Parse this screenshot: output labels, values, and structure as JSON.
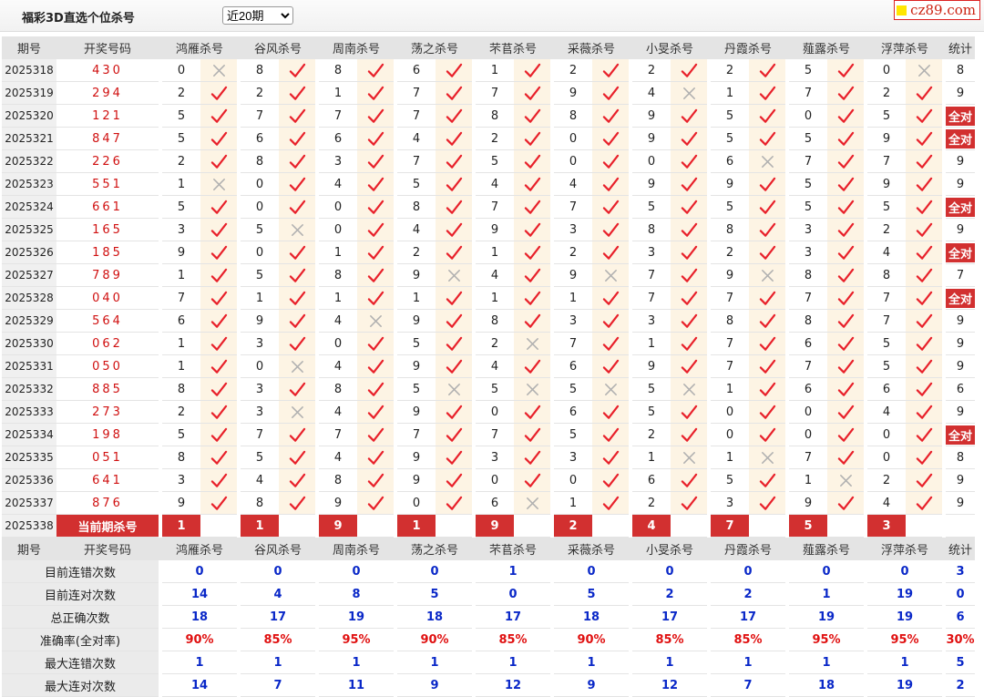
{
  "header": {
    "title": "福彩3D直选个位杀号",
    "range_selected": "近20期",
    "logo_text": "cz89.com"
  },
  "columns": {
    "period": "期号",
    "draw": "开奖号码",
    "stat": "统计",
    "experts": [
      "鸿雁杀号",
      "谷风杀号",
      "周南杀号",
      "荡之杀号",
      "芣苢杀号",
      "采薇杀号",
      "小旻杀号",
      "丹霞杀号",
      "薤露杀号",
      "浮萍杀号"
    ]
  },
  "rows": [
    {
      "period": "2025318",
      "draw": "430",
      "kills": [
        [
          "0",
          "x"
        ],
        [
          "8",
          "v"
        ],
        [
          "8",
          "v"
        ],
        [
          "6",
          "v"
        ],
        [
          "1",
          "v"
        ],
        [
          "2",
          "v"
        ],
        [
          "2",
          "v"
        ],
        [
          "2",
          "v"
        ],
        [
          "5",
          "v"
        ],
        [
          "0",
          "x"
        ]
      ],
      "stat": "8"
    },
    {
      "period": "2025319",
      "draw": "294",
      "kills": [
        [
          "2",
          "v"
        ],
        [
          "2",
          "v"
        ],
        [
          "1",
          "v"
        ],
        [
          "7",
          "v"
        ],
        [
          "7",
          "v"
        ],
        [
          "9",
          "v"
        ],
        [
          "4",
          "x"
        ],
        [
          "1",
          "v"
        ],
        [
          "7",
          "v"
        ],
        [
          "2",
          "v"
        ]
      ],
      "stat": "9"
    },
    {
      "period": "2025320",
      "draw": "121",
      "kills": [
        [
          "5",
          "v"
        ],
        [
          "7",
          "v"
        ],
        [
          "7",
          "v"
        ],
        [
          "7",
          "v"
        ],
        [
          "8",
          "v"
        ],
        [
          "8",
          "v"
        ],
        [
          "9",
          "v"
        ],
        [
          "5",
          "v"
        ],
        [
          "0",
          "v"
        ],
        [
          "5",
          "v"
        ]
      ],
      "stat": "全对"
    },
    {
      "period": "2025321",
      "draw": "847",
      "kills": [
        [
          "5",
          "v"
        ],
        [
          "6",
          "v"
        ],
        [
          "6",
          "v"
        ],
        [
          "4",
          "v"
        ],
        [
          "2",
          "v"
        ],
        [
          "0",
          "v"
        ],
        [
          "9",
          "v"
        ],
        [
          "5",
          "v"
        ],
        [
          "5",
          "v"
        ],
        [
          "9",
          "v"
        ]
      ],
      "stat": "全对"
    },
    {
      "period": "2025322",
      "draw": "226",
      "kills": [
        [
          "2",
          "v"
        ],
        [
          "8",
          "v"
        ],
        [
          "3",
          "v"
        ],
        [
          "7",
          "v"
        ],
        [
          "5",
          "v"
        ],
        [
          "0",
          "v"
        ],
        [
          "0",
          "v"
        ],
        [
          "6",
          "x"
        ],
        [
          "7",
          "v"
        ],
        [
          "7",
          "v"
        ]
      ],
      "stat": "9"
    },
    {
      "period": "2025323",
      "draw": "551",
      "kills": [
        [
          "1",
          "x"
        ],
        [
          "0",
          "v"
        ],
        [
          "4",
          "v"
        ],
        [
          "5",
          "v"
        ],
        [
          "4",
          "v"
        ],
        [
          "4",
          "v"
        ],
        [
          "9",
          "v"
        ],
        [
          "9",
          "v"
        ],
        [
          "5",
          "v"
        ],
        [
          "9",
          "v"
        ]
      ],
      "stat": "9"
    },
    {
      "period": "2025324",
      "draw": "661",
      "kills": [
        [
          "5",
          "v"
        ],
        [
          "0",
          "v"
        ],
        [
          "0",
          "v"
        ],
        [
          "8",
          "v"
        ],
        [
          "7",
          "v"
        ],
        [
          "7",
          "v"
        ],
        [
          "5",
          "v"
        ],
        [
          "5",
          "v"
        ],
        [
          "5",
          "v"
        ],
        [
          "5",
          "v"
        ]
      ],
      "stat": "全对"
    },
    {
      "period": "2025325",
      "draw": "165",
      "kills": [
        [
          "3",
          "v"
        ],
        [
          "5",
          "x"
        ],
        [
          "0",
          "v"
        ],
        [
          "4",
          "v"
        ],
        [
          "9",
          "v"
        ],
        [
          "3",
          "v"
        ],
        [
          "8",
          "v"
        ],
        [
          "8",
          "v"
        ],
        [
          "3",
          "v"
        ],
        [
          "2",
          "v"
        ]
      ],
      "stat": "9"
    },
    {
      "period": "2025326",
      "draw": "185",
      "kills": [
        [
          "9",
          "v"
        ],
        [
          "0",
          "v"
        ],
        [
          "1",
          "v"
        ],
        [
          "2",
          "v"
        ],
        [
          "1",
          "v"
        ],
        [
          "2",
          "v"
        ],
        [
          "3",
          "v"
        ],
        [
          "2",
          "v"
        ],
        [
          "3",
          "v"
        ],
        [
          "4",
          "v"
        ]
      ],
      "stat": "全对"
    },
    {
      "period": "2025327",
      "draw": "789",
      "kills": [
        [
          "1",
          "v"
        ],
        [
          "5",
          "v"
        ],
        [
          "8",
          "v"
        ],
        [
          "9",
          "x"
        ],
        [
          "4",
          "v"
        ],
        [
          "9",
          "x"
        ],
        [
          "7",
          "v"
        ],
        [
          "9",
          "x"
        ],
        [
          "8",
          "v"
        ],
        [
          "8",
          "v"
        ]
      ],
      "stat": "7"
    },
    {
      "period": "2025328",
      "draw": "040",
      "kills": [
        [
          "7",
          "v"
        ],
        [
          "1",
          "v"
        ],
        [
          "1",
          "v"
        ],
        [
          "1",
          "v"
        ],
        [
          "1",
          "v"
        ],
        [
          "1",
          "v"
        ],
        [
          "7",
          "v"
        ],
        [
          "7",
          "v"
        ],
        [
          "7",
          "v"
        ],
        [
          "7",
          "v"
        ]
      ],
      "stat": "全对"
    },
    {
      "period": "2025329",
      "draw": "564",
      "kills": [
        [
          "6",
          "v"
        ],
        [
          "9",
          "v"
        ],
        [
          "4",
          "x"
        ],
        [
          "9",
          "v"
        ],
        [
          "8",
          "v"
        ],
        [
          "3",
          "v"
        ],
        [
          "3",
          "v"
        ],
        [
          "8",
          "v"
        ],
        [
          "8",
          "v"
        ],
        [
          "7",
          "v"
        ]
      ],
      "stat": "9"
    },
    {
      "period": "2025330",
      "draw": "062",
      "kills": [
        [
          "1",
          "v"
        ],
        [
          "3",
          "v"
        ],
        [
          "0",
          "v"
        ],
        [
          "5",
          "v"
        ],
        [
          "2",
          "x"
        ],
        [
          "7",
          "v"
        ],
        [
          "1",
          "v"
        ],
        [
          "7",
          "v"
        ],
        [
          "6",
          "v"
        ],
        [
          "5",
          "v"
        ]
      ],
      "stat": "9"
    },
    {
      "period": "2025331",
      "draw": "050",
      "kills": [
        [
          "1",
          "v"
        ],
        [
          "0",
          "x"
        ],
        [
          "4",
          "v"
        ],
        [
          "9",
          "v"
        ],
        [
          "4",
          "v"
        ],
        [
          "6",
          "v"
        ],
        [
          "9",
          "v"
        ],
        [
          "7",
          "v"
        ],
        [
          "7",
          "v"
        ],
        [
          "5",
          "v"
        ]
      ],
      "stat": "9"
    },
    {
      "period": "2025332",
      "draw": "885",
      "kills": [
        [
          "8",
          "v"
        ],
        [
          "3",
          "v"
        ],
        [
          "8",
          "v"
        ],
        [
          "5",
          "x"
        ],
        [
          "5",
          "x"
        ],
        [
          "5",
          "x"
        ],
        [
          "5",
          "x"
        ],
        [
          "1",
          "v"
        ],
        [
          "6",
          "v"
        ],
        [
          "6",
          "v"
        ]
      ],
      "stat": "6"
    },
    {
      "period": "2025333",
      "draw": "273",
      "kills": [
        [
          "2",
          "v"
        ],
        [
          "3",
          "x"
        ],
        [
          "4",
          "v"
        ],
        [
          "9",
          "v"
        ],
        [
          "0",
          "v"
        ],
        [
          "6",
          "v"
        ],
        [
          "5",
          "v"
        ],
        [
          "0",
          "v"
        ],
        [
          "0",
          "v"
        ],
        [
          "4",
          "v"
        ]
      ],
      "stat": "9"
    },
    {
      "period": "2025334",
      "draw": "198",
      "kills": [
        [
          "5",
          "v"
        ],
        [
          "7",
          "v"
        ],
        [
          "7",
          "v"
        ],
        [
          "7",
          "v"
        ],
        [
          "7",
          "v"
        ],
        [
          "5",
          "v"
        ],
        [
          "2",
          "v"
        ],
        [
          "0",
          "v"
        ],
        [
          "0",
          "v"
        ],
        [
          "0",
          "v"
        ]
      ],
      "stat": "全对"
    },
    {
      "period": "2025335",
      "draw": "051",
      "kills": [
        [
          "8",
          "v"
        ],
        [
          "5",
          "v"
        ],
        [
          "4",
          "v"
        ],
        [
          "9",
          "v"
        ],
        [
          "3",
          "v"
        ],
        [
          "3",
          "v"
        ],
        [
          "1",
          "x"
        ],
        [
          "1",
          "x"
        ],
        [
          "7",
          "v"
        ],
        [
          "0",
          "v"
        ]
      ],
      "stat": "8"
    },
    {
      "period": "2025336",
      "draw": "641",
      "kills": [
        [
          "3",
          "v"
        ],
        [
          "4",
          "v"
        ],
        [
          "8",
          "v"
        ],
        [
          "9",
          "v"
        ],
        [
          "0",
          "v"
        ],
        [
          "0",
          "v"
        ],
        [
          "6",
          "v"
        ],
        [
          "5",
          "v"
        ],
        [
          "1",
          "x"
        ],
        [
          "2",
          "v"
        ]
      ],
      "stat": "9"
    },
    {
      "period": "2025337",
      "draw": "876",
      "kills": [
        [
          "9",
          "v"
        ],
        [
          "8",
          "v"
        ],
        [
          "9",
          "v"
        ],
        [
          "0",
          "v"
        ],
        [
          "6",
          "x"
        ],
        [
          "1",
          "v"
        ],
        [
          "2",
          "v"
        ],
        [
          "3",
          "v"
        ],
        [
          "9",
          "v"
        ],
        [
          "4",
          "v"
        ]
      ],
      "stat": "9"
    }
  ],
  "current": {
    "period": "2025338",
    "label": "当前期杀号",
    "kills": [
      "1",
      "1",
      "9",
      "1",
      "9",
      "2",
      "4",
      "7",
      "5",
      "3"
    ]
  },
  "summary": [
    {
      "label": "目前连错次数",
      "values": [
        "0",
        "0",
        "0",
        "0",
        "1",
        "0",
        "0",
        "0",
        "0",
        "0"
      ],
      "stat": "3",
      "red": false
    },
    {
      "label": "目前连对次数",
      "values": [
        "14",
        "4",
        "8",
        "5",
        "0",
        "5",
        "2",
        "2",
        "1",
        "19"
      ],
      "stat": "0",
      "red": false
    },
    {
      "label": "总正确次数",
      "values": [
        "18",
        "17",
        "19",
        "18",
        "17",
        "18",
        "17",
        "17",
        "19",
        "19"
      ],
      "stat": "6",
      "red": false
    },
    {
      "label": "准确率(全对率)",
      "values": [
        "90%",
        "85%",
        "95%",
        "90%",
        "85%",
        "90%",
        "85%",
        "85%",
        "95%",
        "95%"
      ],
      "stat": "30%",
      "red": true
    },
    {
      "label": "最大连错次数",
      "values": [
        "1",
        "1",
        "1",
        "1",
        "1",
        "1",
        "1",
        "1",
        "1",
        "1"
      ],
      "stat": "5",
      "red": false
    },
    {
      "label": "最大连对次数",
      "values": [
        "14",
        "7",
        "11",
        "9",
        "12",
        "9",
        "12",
        "7",
        "18",
        "19"
      ],
      "stat": "2",
      "red": false
    }
  ],
  "colors": {
    "accent_red": "#d23030",
    "check_red": "#e8202a",
    "cross_gray": "#b0b0b0",
    "summary_blue": "#0a28c8"
  }
}
